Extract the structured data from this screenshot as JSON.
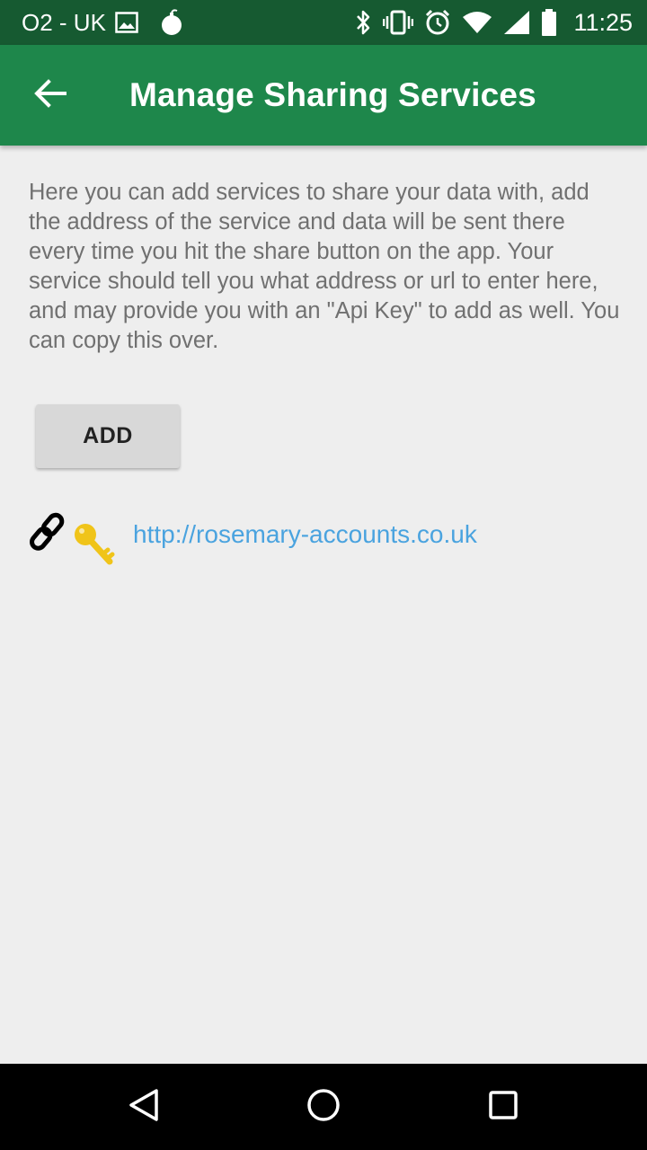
{
  "status_bar": {
    "carrier": "O2 - UK",
    "time": "11:25",
    "icons": [
      "image-icon",
      "bomb-icon",
      "bluetooth-icon",
      "vibrate-icon",
      "alarm-icon",
      "wifi-icon",
      "signal-icon",
      "battery-icon"
    ]
  },
  "app_bar": {
    "title": "Manage Sharing Services",
    "back_icon": "arrow-back-icon",
    "background_color": "#1e874b"
  },
  "main": {
    "description": "Here you can add services to share your data with, add the address of the service and data will be sent there every time you hit the share button on the app. Your service should tell you what address or url to enter here, and may provide you with an \"Api Key\" to add as well. You can copy this over.",
    "add_button_label": "ADD",
    "services": [
      {
        "url": "http://rosemary-accounts.co.uk",
        "icon": "link-key-icon"
      }
    ]
  },
  "nav_bar": {
    "icons": [
      "back-triangle-icon",
      "home-circle-icon",
      "recents-square-icon"
    ]
  },
  "colors": {
    "status_bar": "#165a31",
    "link": "#4aa3df",
    "background": "#eeeeee"
  }
}
